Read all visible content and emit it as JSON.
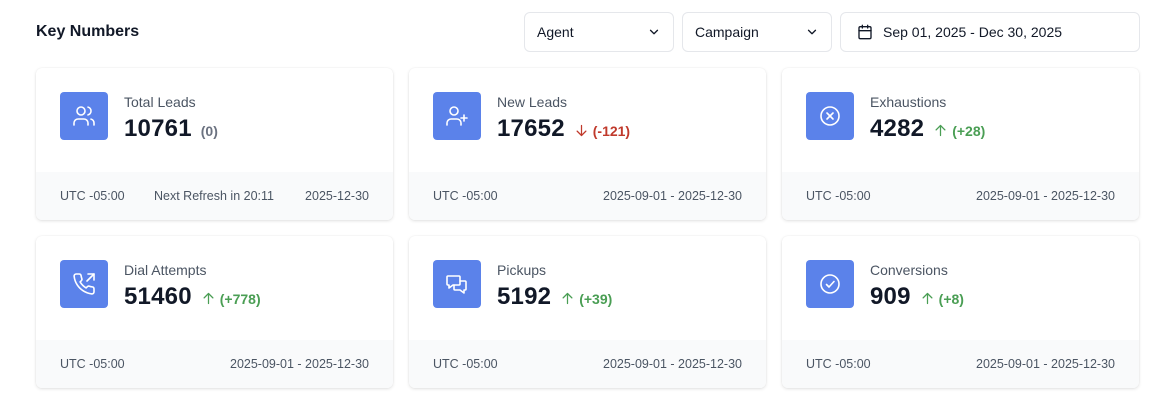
{
  "header": {
    "title": "Key Numbers",
    "agent_filter": "Agent",
    "campaign_filter": "Campaign",
    "date_range": "Sep 01, 2025 - Dec 30, 2025"
  },
  "cards": [
    {
      "label": "Total Leads",
      "value": "10761",
      "delta": "(0)",
      "trend": "neutral",
      "icon": "users-icon",
      "timezone": "UTC -05:00",
      "refresh": "Next Refresh in 20:11",
      "range": "2025-12-30"
    },
    {
      "label": "New Leads",
      "value": "17652",
      "delta": "(-121)",
      "trend": "down",
      "icon": "user-plus-icon",
      "timezone": "UTC -05:00",
      "range": "2025-09-01 - 2025-12-30"
    },
    {
      "label": "Exhaustions",
      "value": "4282",
      "delta": "(+28)",
      "trend": "up",
      "icon": "x-circle-icon",
      "timezone": "UTC -05:00",
      "range": "2025-09-01 - 2025-12-30"
    },
    {
      "label": "Dial Attempts",
      "value": "51460",
      "delta": "(+778)",
      "trend": "up",
      "icon": "phone-outgoing-icon",
      "timezone": "UTC -05:00",
      "range": "2025-09-01 - 2025-12-30"
    },
    {
      "label": "Pickups",
      "value": "5192",
      "delta": "(+39)",
      "trend": "up",
      "icon": "chat-bubbles-icon",
      "timezone": "UTC -05:00",
      "range": "2025-09-01 - 2025-12-30"
    },
    {
      "label": "Conversions",
      "value": "909",
      "delta": "(+8)",
      "trend": "up",
      "icon": "check-circle-icon",
      "timezone": "UTC -05:00",
      "range": "2025-09-01 - 2025-12-30"
    }
  ],
  "colors": {
    "icon_bg": "#5b82ea",
    "up": "#4a9e54",
    "down": "#c0392b",
    "neutral": "#6b7280"
  }
}
